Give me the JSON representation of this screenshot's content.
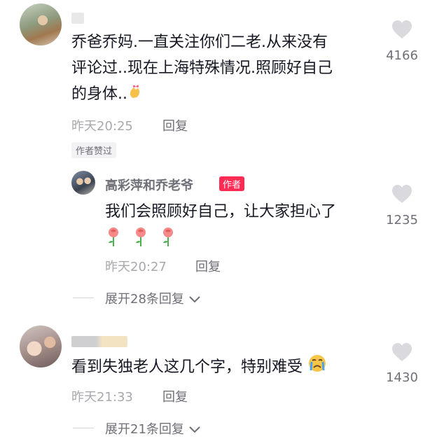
{
  "comments": [
    {
      "text_line1": "乔爸乔妈.一直关注你们二老.从来没有",
      "text_line2": "评论过..现在上海特殊情况.照顾好自己",
      "text_line3": "的身体..",
      "text_emoji": "finger-heart-icon",
      "time": "昨天20:25",
      "reply_label": "回复",
      "badge": "作者赞过",
      "likes": "4166"
    },
    {
      "author": "高彩萍和乔老爷",
      "author_tag": "作者",
      "text": "我们会照顾好自己，让大家担心了",
      "text_emoji": "rose-icon",
      "time": "昨天20:27",
      "reply_label": "回复",
      "likes": "1235"
    },
    {
      "text": "看到失独老人这几个字，特别难受",
      "text_emoji": "crying-face-icon",
      "time": "昨天21:33",
      "reply_label": "回复",
      "likes": "1430"
    }
  ],
  "expand_replies": [
    {
      "label": "展开28条回复"
    },
    {
      "label": "展开21条回复"
    }
  ],
  "colors": {
    "author_tag": "#fe2c55",
    "secondary_text": "#a8a9ae",
    "heart": "#d9d9de"
  }
}
